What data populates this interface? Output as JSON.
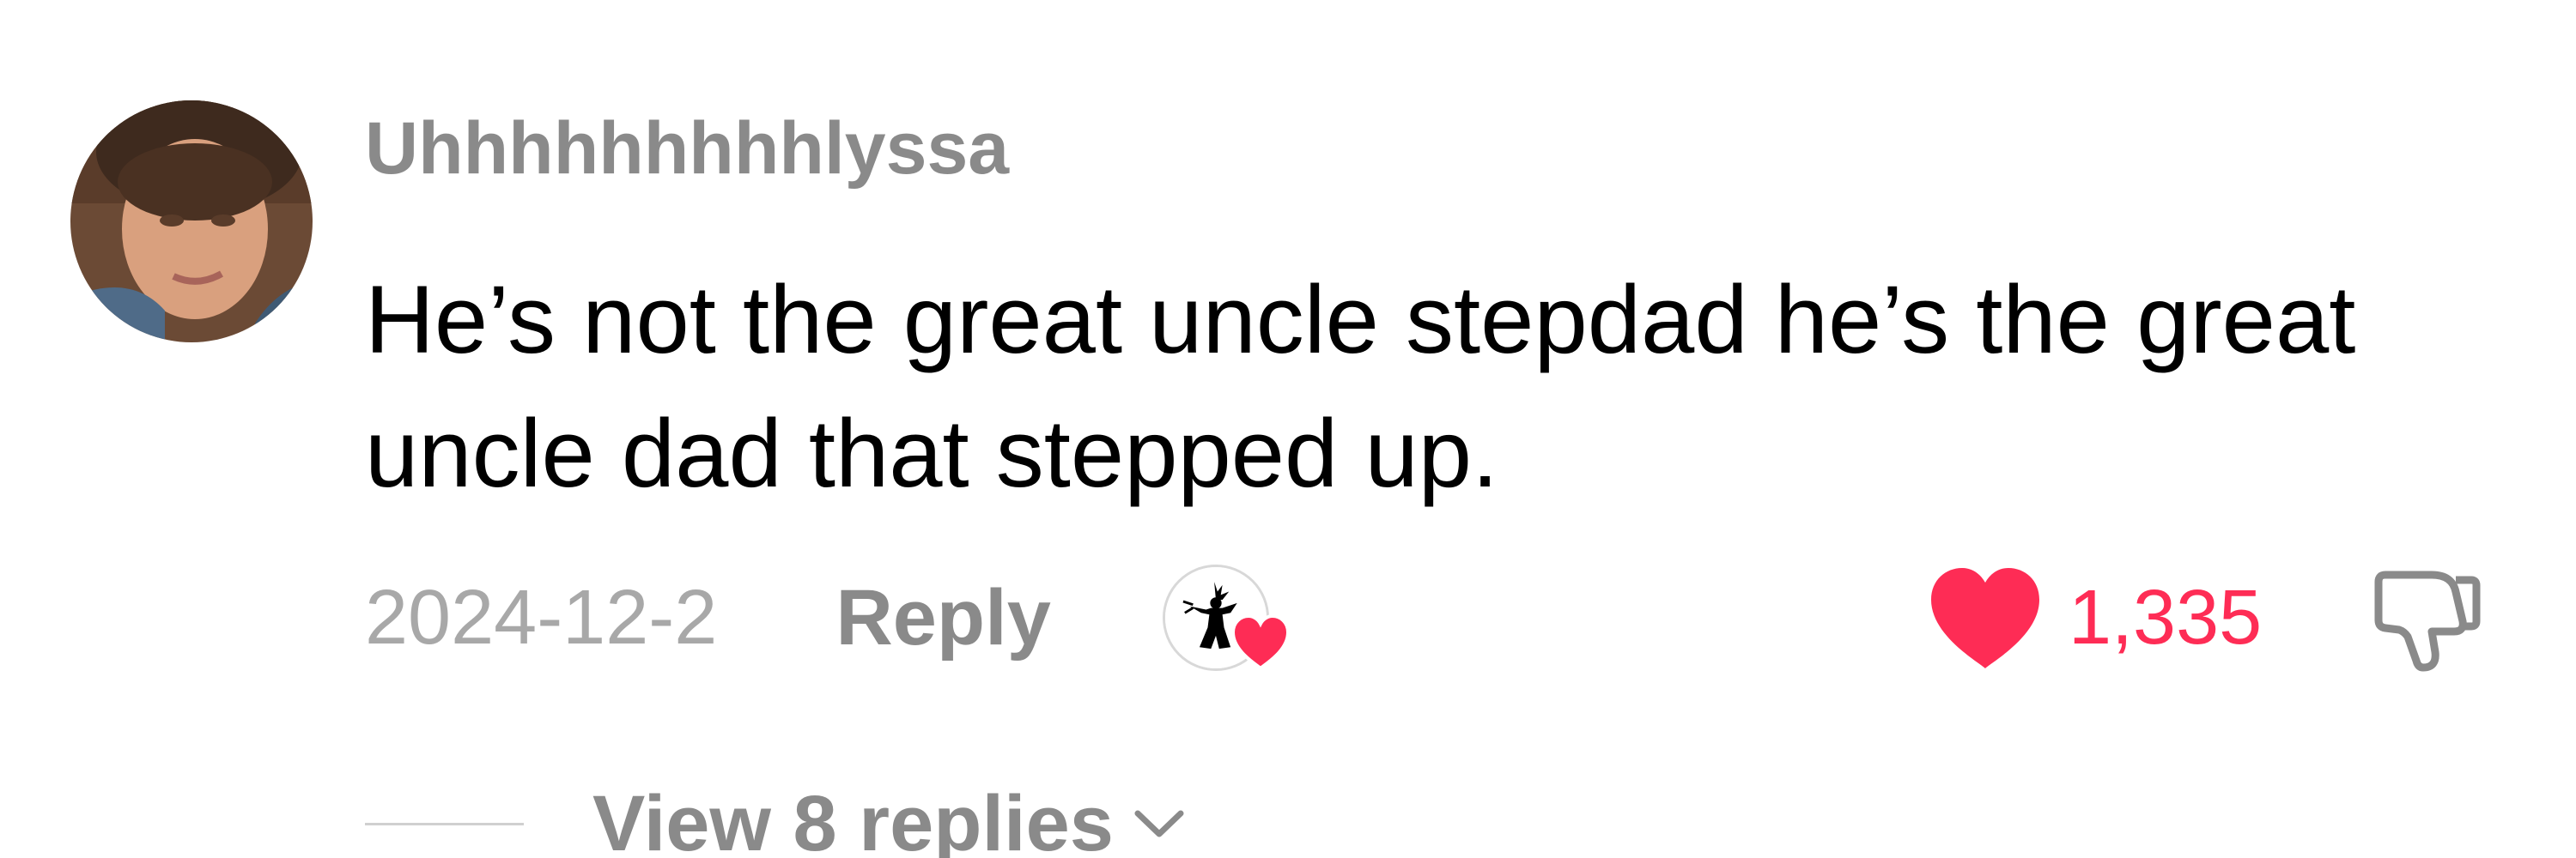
{
  "comment": {
    "username": "Uhhhhhhhhhlyssa",
    "text": "He’s not the great uncle stepdad he’s the great uncle dad that stepped up.",
    "date": "2024-12-2",
    "reply_label": "Reply",
    "like_count": "1,335",
    "liked_by_creator": true,
    "view_replies_label": "View 8 replies"
  },
  "icons": {
    "avatar": "user-avatar-photo",
    "creator_badge": "creator-liked-badge",
    "like": "heart-icon",
    "dislike": "thumbs-down-icon",
    "expand": "chevron-down-icon"
  },
  "colors": {
    "like": "#fe2c55",
    "muted_text": "#8a8a8a",
    "date_text": "#a8a8a8",
    "body_text": "#000000"
  }
}
